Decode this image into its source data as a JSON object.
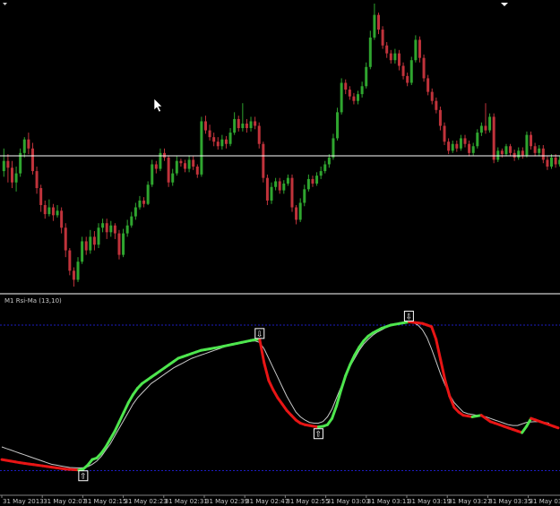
{
  "indicator": {
    "label": "M1  Rsi-Ma (13,10)",
    "arrow_up": "⇧",
    "arrow_down": "⇩"
  },
  "time_axis": {
    "labels": [
      "31 May 2013",
      "31 May 02:07",
      "31 May 02:15",
      "31 May 02:23",
      "31 May 02:31",
      "31 May 02:39",
      "31 May 02:47",
      "31 May 02:55",
      "31 May 03:03",
      "31 May 03:11",
      "31 May 03:19",
      "31 May 03:27",
      "31 May 03:35",
      "31 May 03:43"
    ]
  },
  "colors": {
    "background": "#000000",
    "bull": "#2fa52f",
    "bear": "#c0333b",
    "rsi_up": "#4ee64e",
    "rsi_down": "#e81515",
    "ma_line": "#c8c8c8",
    "level_line": "#1c1cc0",
    "separator": "#808080",
    "hline": "#ffffff"
  },
  "chart_data": {
    "type": "candlestick",
    "price_panel": {
      "candles": [
        [
          0.0,
          0.9,
          2.0,
          -0.5
        ],
        [
          0.9,
          0.3,
          1.5,
          -1.0
        ],
        [
          0.3,
          -1.0,
          0.9,
          -1.5
        ],
        [
          -1.0,
          -0.2,
          0.4,
          -1.8
        ],
        [
          -0.2,
          1.6,
          2.0,
          -0.5
        ],
        [
          1.6,
          2.8,
          3.0,
          1.2
        ],
        [
          2.8,
          2.0,
          3.4,
          1.5
        ],
        [
          2.0,
          0.0,
          2.5,
          -0.3
        ],
        [
          0.0,
          -1.5,
          0.4,
          -2.0
        ],
        [
          -1.5,
          -3.0,
          -1.2,
          -3.6
        ],
        [
          -3.0,
          -3.8,
          -2.6,
          -4.2
        ],
        [
          -3.8,
          -3.2,
          -2.5,
          -4.0
        ],
        [
          -3.2,
          -3.9,
          -2.9,
          -4.4
        ],
        [
          -3.9,
          -3.5,
          -3.0,
          -4.1
        ],
        [
          -3.5,
          -5.0,
          -3.2,
          -5.5
        ],
        [
          -5.0,
          -7.0,
          -4.6,
          -7.6
        ],
        [
          -7.0,
          -8.8,
          -6.8,
          -9.2
        ],
        [
          -8.8,
          -9.6,
          -8.5,
          -10.2
        ],
        [
          -9.6,
          -8.0,
          -7.6,
          -9.8
        ],
        [
          -8.0,
          -6.2,
          -5.8,
          -8.2
        ],
        [
          -6.2,
          -7.0,
          -5.8,
          -7.4
        ],
        [
          -7.0,
          -5.8,
          -5.2,
          -7.3
        ],
        [
          -5.8,
          -6.5,
          -5.3,
          -7.0
        ],
        [
          -6.5,
          -5.0,
          -4.6,
          -6.8
        ],
        [
          -5.0,
          -4.6,
          -4.2,
          -5.4
        ],
        [
          -4.6,
          -5.4,
          -4.2,
          -6.0
        ],
        [
          -5.4,
          -4.8,
          -4.4,
          -5.8
        ],
        [
          -4.8,
          -5.5,
          -4.6,
          -6.0
        ],
        [
          -5.5,
          -7.4,
          -5.2,
          -7.8
        ],
        [
          -7.4,
          -5.5,
          -5.1,
          -7.6
        ],
        [
          -5.5,
          -4.8,
          -4.3,
          -5.8
        ],
        [
          -4.8,
          -4.0,
          -3.6,
          -5.0
        ],
        [
          -4.0,
          -3.2,
          -2.8,
          -4.3
        ],
        [
          -3.2,
          -2.6,
          -2.2,
          -3.4
        ],
        [
          -2.6,
          -2.9,
          -2.3,
          -3.2
        ],
        [
          -2.9,
          -1.2,
          -0.9,
          -3.0
        ],
        [
          -1.2,
          0.6,
          1.0,
          -1.4
        ],
        [
          0.6,
          0.2,
          0.9,
          -0.2
        ],
        [
          0.2,
          1.6,
          2.0,
          0.0
        ],
        [
          1.6,
          1.2,
          2.0,
          0.9
        ],
        [
          1.2,
          -1.0,
          1.4,
          -1.4
        ],
        [
          -1.0,
          -0.2,
          0.2,
          -1.3
        ],
        [
          -0.2,
          0.9,
          1.3,
          -0.4
        ],
        [
          0.9,
          0.7,
          1.1,
          0.4
        ],
        [
          0.7,
          0.2,
          1.0,
          -0.1
        ],
        [
          0.2,
          1.0,
          1.4,
          -0.1
        ],
        [
          1.0,
          0.4,
          1.3,
          0.1
        ],
        [
          0.4,
          -0.3,
          0.6,
          -0.6
        ],
        [
          -0.3,
          4.4,
          4.8,
          -0.5
        ],
        [
          4.4,
          3.6,
          4.9,
          3.3
        ],
        [
          3.6,
          3.0,
          4.1,
          2.7
        ],
        [
          3.0,
          2.6,
          3.4,
          2.2
        ],
        [
          2.6,
          2.2,
          3.0,
          1.9
        ],
        [
          2.2,
          2.8,
          3.2,
          1.9
        ],
        [
          2.8,
          2.4,
          3.1,
          2.0
        ],
        [
          2.4,
          3.4,
          3.8,
          2.2
        ],
        [
          3.4,
          4.6,
          5.2,
          3.2
        ],
        [
          4.6,
          3.8,
          4.9,
          3.5
        ],
        [
          3.8,
          4.2,
          6.0,
          3.5
        ],
        [
          4.2,
          3.8,
          4.6,
          3.4
        ],
        [
          3.8,
          4.4,
          4.8,
          3.5
        ],
        [
          4.4,
          4.0,
          4.8,
          3.7
        ],
        [
          4.0,
          2.4,
          4.3,
          2.0
        ],
        [
          2.4,
          -0.6,
          2.6,
          -1.0
        ],
        [
          -0.6,
          -2.6,
          -0.3,
          -3.0
        ],
        [
          -2.6,
          -1.4,
          -1.0,
          -2.9
        ],
        [
          -1.4,
          -0.9,
          -0.6,
          -1.7
        ],
        [
          -0.9,
          -1.7,
          -0.6,
          -2.0
        ],
        [
          -1.7,
          -1.1,
          -0.8,
          -2.0
        ],
        [
          -1.1,
          -0.6,
          -0.3,
          -1.3
        ],
        [
          -0.6,
          -3.2,
          -0.3,
          -3.6
        ],
        [
          -3.2,
          -4.3,
          -3.0,
          -4.7
        ],
        [
          -4.3,
          -2.8,
          -2.4,
          -4.5
        ],
        [
          -2.8,
          -1.6,
          -1.2,
          -3.1
        ],
        [
          -1.6,
          -0.7,
          -0.3,
          -1.8
        ],
        [
          -0.7,
          -1.1,
          -0.4,
          -1.4
        ],
        [
          -1.1,
          -0.4,
          -0.1,
          -1.3
        ],
        [
          -0.4,
          0.0,
          0.4,
          -0.7
        ],
        [
          0.0,
          0.6,
          0.9,
          -0.2
        ],
        [
          0.6,
          1.2,
          1.5,
          0.3
        ],
        [
          1.2,
          2.9,
          3.3,
          1.0
        ],
        [
          2.9,
          5.2,
          5.6,
          2.7
        ],
        [
          5.2,
          7.8,
          8.2,
          5.0
        ],
        [
          7.8,
          7.2,
          8.1,
          6.8
        ],
        [
          7.2,
          6.6,
          7.5,
          6.3
        ],
        [
          6.6,
          6.2,
          6.9,
          5.9
        ],
        [
          6.2,
          6.8,
          7.1,
          5.9
        ],
        [
          6.8,
          7.5,
          7.9,
          6.5
        ],
        [
          7.5,
          9.2,
          9.6,
          7.3
        ],
        [
          9.2,
          11.8,
          12.4,
          9.0
        ],
        [
          11.8,
          13.8,
          14.8,
          11.6
        ],
        [
          13.8,
          12.5,
          14.0,
          12.1
        ],
        [
          12.5,
          11.1,
          12.8,
          10.8
        ],
        [
          11.1,
          10.4,
          11.4,
          10.0
        ],
        [
          10.4,
          9.8,
          10.7,
          9.5
        ],
        [
          9.8,
          10.4,
          10.8,
          9.5
        ],
        [
          10.4,
          9.3,
          10.7,
          8.9
        ],
        [
          9.3,
          8.4,
          9.6,
          8.1
        ],
        [
          8.4,
          7.8,
          8.7,
          7.5
        ],
        [
          7.8,
          9.8,
          10.1,
          7.6
        ],
        [
          9.8,
          11.6,
          12.0,
          9.6
        ],
        [
          11.6,
          10.0,
          11.9,
          9.6
        ],
        [
          10.0,
          8.2,
          10.3,
          7.9
        ],
        [
          8.2,
          7.0,
          8.5,
          6.7
        ],
        [
          7.0,
          6.2,
          7.3,
          5.9
        ],
        [
          6.2,
          5.4,
          6.5,
          5.1
        ],
        [
          5.4,
          4.0,
          5.7,
          3.6
        ],
        [
          4.0,
          2.6,
          4.3,
          2.3
        ],
        [
          2.6,
          1.8,
          2.9,
          1.5
        ],
        [
          1.8,
          2.4,
          2.7,
          1.6
        ],
        [
          2.4,
          2.0,
          2.7,
          1.7
        ],
        [
          2.0,
          2.9,
          3.2,
          1.8
        ],
        [
          2.9,
          2.4,
          3.2,
          2.1
        ],
        [
          2.4,
          1.6,
          2.7,
          1.3
        ],
        [
          1.6,
          2.2,
          2.5,
          1.4
        ],
        [
          2.2,
          3.4,
          3.7,
          2.0
        ],
        [
          3.4,
          4.0,
          4.3,
          3.1
        ],
        [
          4.0,
          3.6,
          6.0,
          3.3
        ],
        [
          3.6,
          4.8,
          5.1,
          3.4
        ],
        [
          4.8,
          1.0,
          5.1,
          0.7
        ],
        [
          1.0,
          1.8,
          2.1,
          0.8
        ],
        [
          1.8,
          1.5,
          2.0,
          1.2
        ],
        [
          1.5,
          2.2,
          2.4,
          1.3
        ],
        [
          2.2,
          1.6,
          2.4,
          1.3
        ],
        [
          1.6,
          1.2,
          1.9,
          0.9
        ],
        [
          1.2,
          1.8,
          2.1,
          1.0
        ],
        [
          1.8,
          1.4,
          2.1,
          1.1
        ],
        [
          1.4,
          3.2,
          3.5,
          1.2
        ],
        [
          3.2,
          2.2,
          3.5,
          1.9
        ],
        [
          2.2,
          1.6,
          2.5,
          1.3
        ],
        [
          1.6,
          2.0,
          2.3,
          1.3
        ],
        [
          2.0,
          1.0,
          2.3,
          0.7
        ],
        [
          1.0,
          0.4,
          1.3,
          0.1
        ],
        [
          0.4,
          1.2,
          1.5,
          0.2
        ],
        [
          1.2,
          0.6,
          1.5,
          0.3
        ],
        [
          0.6,
          1.0,
          1.3,
          0.4
        ]
      ]
    },
    "indicator_panel": {
      "series": [
        {
          "values": [
            22.0,
            21.5,
            21.0,
            20.5,
            20.0,
            19.6,
            19.2,
            18.8,
            18.4,
            18.0,
            17.6,
            17.2,
            16.8,
            16.4,
            16.0,
            15.8,
            15.6,
            15.4,
            16.0,
            18.5,
            22.0,
            23.0,
            26.0,
            30.0,
            35.0,
            40.0,
            46.0,
            52.0,
            58.0,
            63.0,
            67.0,
            70.0,
            72.0,
            74.0,
            76.0,
            78.0,
            80.0,
            82.0,
            84.0,
            86.0,
            87.0,
            88.0,
            89.0,
            90.0,
            91.0,
            91.5,
            92.0,
            92.5,
            93.0,
            93.6,
            94.2,
            94.8,
            95.4,
            96.0,
            96.6,
            97.2,
            97.8,
            98.0,
            83.0,
            72.0,
            66.0,
            61.0,
            57.0,
            53.0,
            50.0,
            47.0,
            45.0,
            44.0,
            43.5,
            43.0,
            42.6,
            43.0,
            44.0,
            48.0,
            56.0,
            66.0,
            75.0,
            82.0,
            88.0,
            93.0,
            97.0,
            100.0,
            102.0,
            103.5,
            105.0,
            106.0,
            107.0,
            107.5,
            108.0,
            108.5,
            109.0,
            108.7,
            108.4,
            108.0,
            107.0,
            106.0,
            98.0,
            85.0,
            72.0,
            62.0,
            55.0,
            52.0,
            50.0,
            49.5,
            49.0,
            49.5,
            50.0,
            48.0,
            46.0,
            45.0,
            44.0,
            43.0,
            42.0,
            41.0,
            40.0,
            39.0,
            43.0,
            48.0,
            47.0,
            46.0,
            45.0,
            44.0,
            43.0,
            42.0
          ]
        },
        {
          "values": [
            30.0,
            29.0,
            28.0,
            27.0,
            26.0,
            25.0,
            24.0,
            23.0,
            22.0,
            21.0,
            20.0,
            19.0,
            18.5,
            18.0,
            17.5,
            17.0,
            16.8,
            16.7,
            16.8,
            17.5,
            19.0,
            21.0,
            24.0,
            28.0,
            32.0,
            37.0,
            42.0,
            47.0,
            52.0,
            57.0,
            61.0,
            64.0,
            67.0,
            70.0,
            72.0,
            74.0,
            76.0,
            78.0,
            80.0,
            81.5,
            83.0,
            84.5,
            86.0,
            87.0,
            88.0,
            89.0,
            90.0,
            91.0,
            92.0,
            93.0,
            94.0,
            94.8,
            95.5,
            96.0,
            96.5,
            96.8,
            97.0,
            96.0,
            92.0,
            86.0,
            80.0,
            74.0,
            68.0,
            62.0,
            57.0,
            52.0,
            49.0,
            47.0,
            45.5,
            45.0,
            45.0,
            46.0,
            49.0,
            54.0,
            61.0,
            68.0,
            75.0,
            81.0,
            86.0,
            91.0,
            95.0,
            98.0,
            100.5,
            102.5,
            104.0,
            105.5,
            107.0,
            107.8,
            108.5,
            109.0,
            109.0,
            108.5,
            107.0,
            104.0,
            99.0,
            92.0,
            84.0,
            76.0,
            69.0,
            63.0,
            58.0,
            55.0,
            52.0,
            51.0,
            50.5,
            50.0,
            49.5,
            49.0,
            48.0,
            47.0,
            46.0,
            45.0,
            44.0,
            43.5,
            43.5,
            44.5,
            45.5,
            45.8,
            46.0,
            45.8,
            45.5,
            45.0
          ]
        }
      ],
      "ylim": [
        0,
        120
      ],
      "levels": [
        15,
        107
      ],
      "signals": [
        {
          "type": "buy",
          "index": 18
        },
        {
          "type": "sell",
          "index": 57
        },
        {
          "type": "buy",
          "index": 70
        },
        {
          "type": "sell",
          "index": 90
        }
      ]
    }
  }
}
